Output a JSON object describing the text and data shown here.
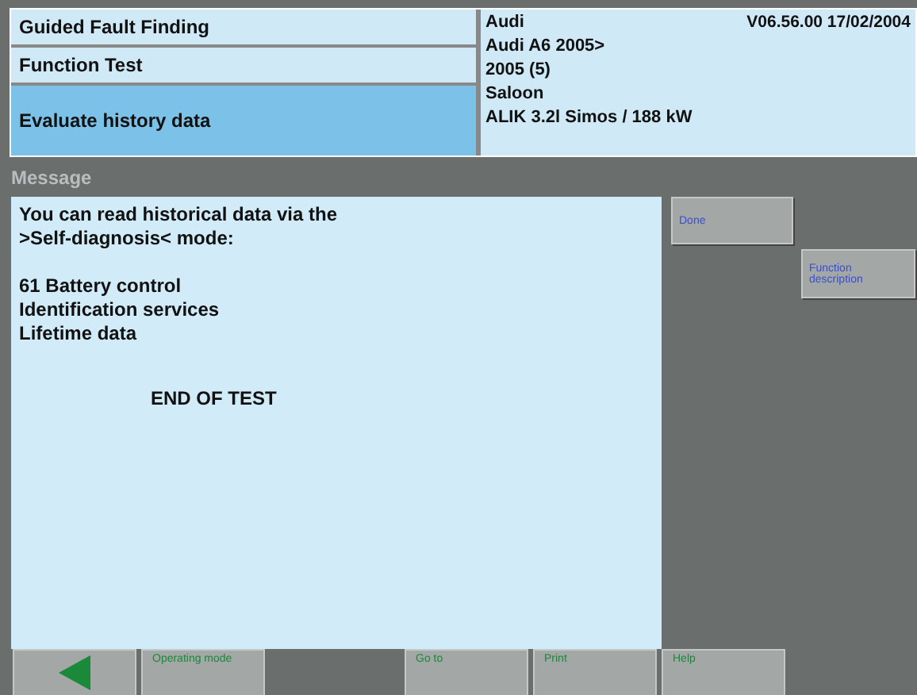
{
  "breadcrumb": [
    {
      "label": "Guided Fault Finding",
      "selected": false
    },
    {
      "label": "Function Test",
      "selected": false
    },
    {
      "label": "Evaluate history data",
      "selected": true
    }
  ],
  "vehicle": {
    "lines": [
      "Audi",
      "Audi A6 2005>",
      "2005 (5)",
      "Saloon",
      "ALIK 3.2l Simos / 188 kW"
    ],
    "version": "V06.56.00 17/02/2004"
  },
  "message": {
    "title": "Message",
    "paragraphs": [
      [
        "You can read historical data via the",
        ">Self-diagnosis< mode:"
      ],
      [
        "61 Battery control",
        "Identification services",
        "Lifetime data"
      ]
    ],
    "status": "END OF TEST"
  },
  "side_buttons": [
    {
      "label": "Done"
    },
    {
      "label": "Function description"
    }
  ],
  "bottom_buttons": [
    {
      "kind": "back"
    },
    {
      "kind": "text",
      "label": "Operating mode"
    },
    {
      "kind": "gap"
    },
    {
      "kind": "text",
      "label": "Go to"
    },
    {
      "kind": "text",
      "label": "Print"
    },
    {
      "kind": "text",
      "label": "Help"
    }
  ]
}
